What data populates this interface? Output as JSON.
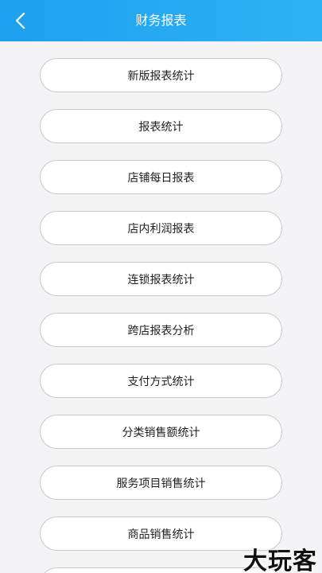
{
  "header": {
    "title": "财务报表",
    "back_icon": "chevron-left-icon"
  },
  "menu": {
    "items": [
      {
        "label": "新版报表统计"
      },
      {
        "label": "报表统计"
      },
      {
        "label": "店铺每日报表"
      },
      {
        "label": "店内利润报表"
      },
      {
        "label": "连锁报表统计"
      },
      {
        "label": "跨店报表分析"
      },
      {
        "label": "支付方式统计"
      },
      {
        "label": "分类销售额统计"
      },
      {
        "label": "服务项目销售统计"
      },
      {
        "label": "商品销售统计"
      },
      {
        "label": ""
      }
    ]
  },
  "watermark": {
    "text": "大玩客"
  },
  "colors": {
    "header_bg": "#1da1f0",
    "page_bg": "#f4f4f6",
    "button_border": "#c9c9c9"
  }
}
